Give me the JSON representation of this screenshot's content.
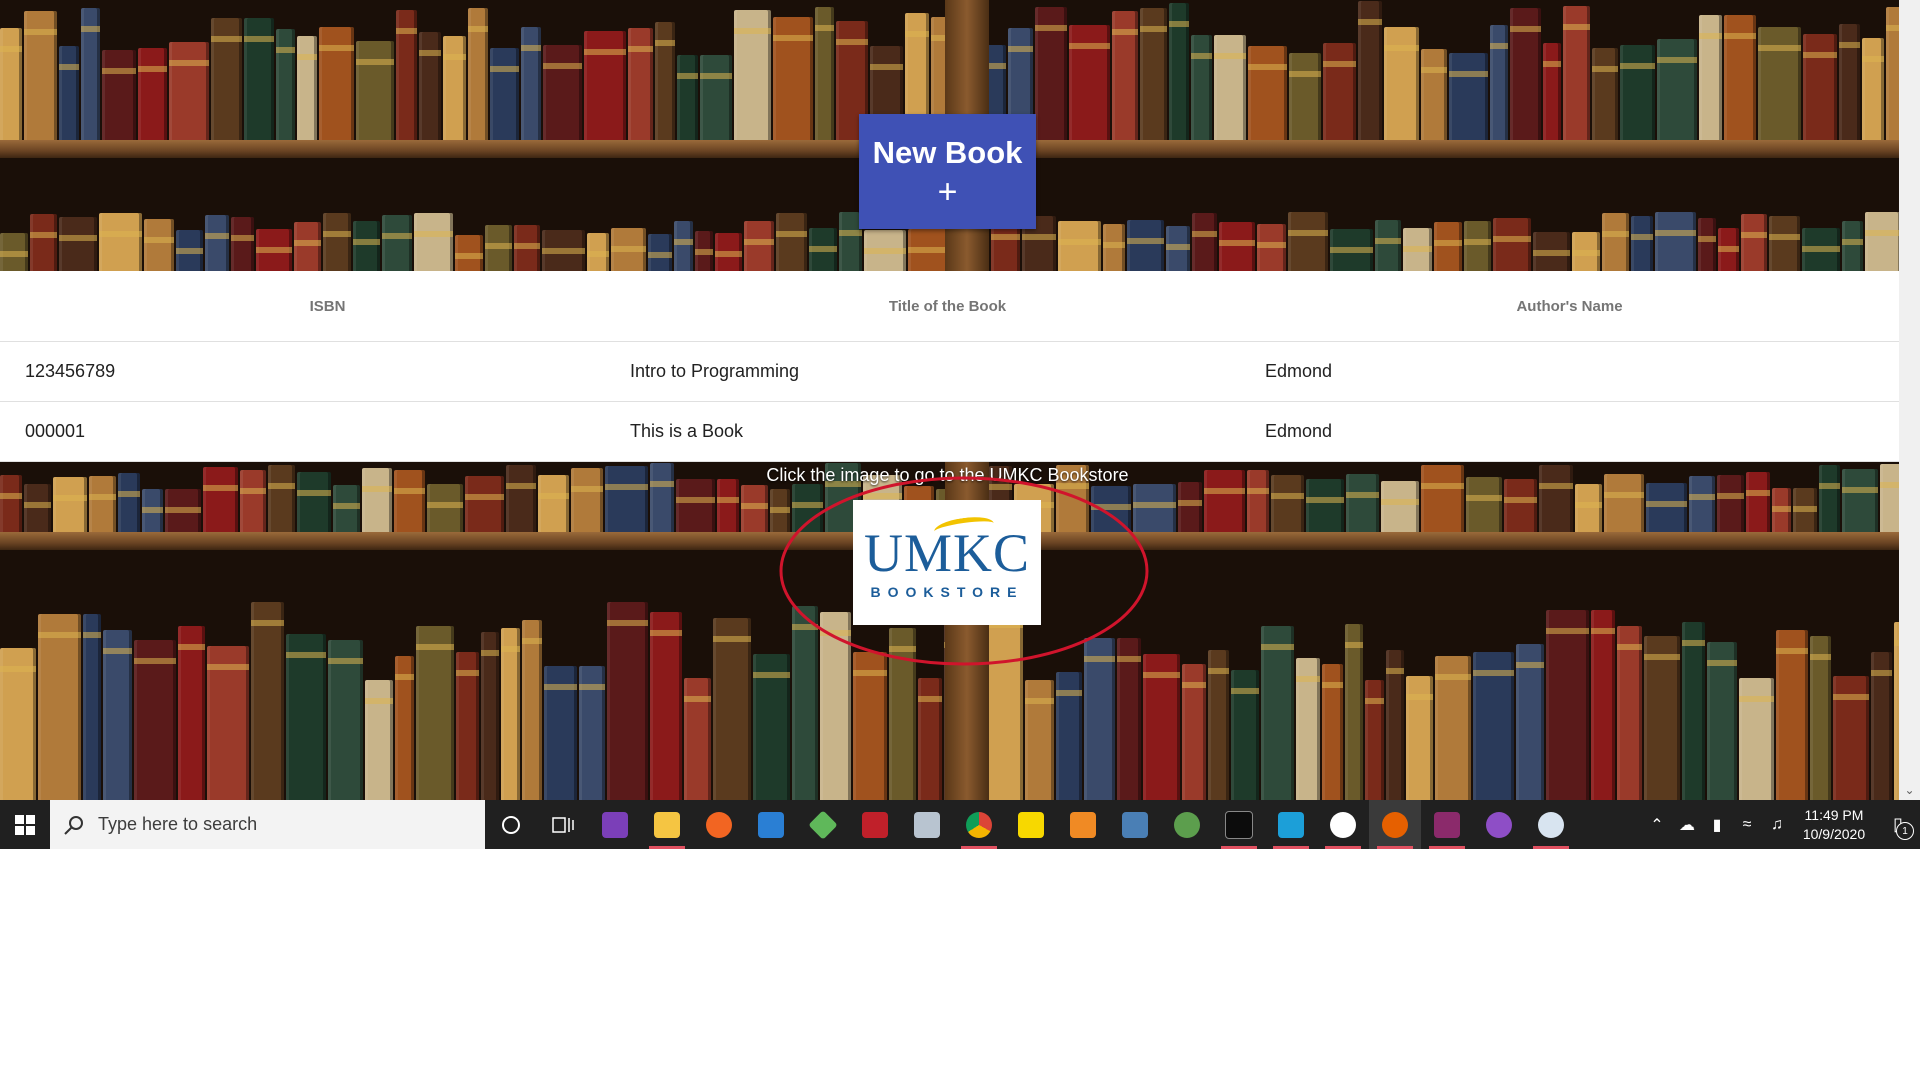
{
  "new_book_button": {
    "label": "New Book",
    "icon": "+"
  },
  "table": {
    "headers": [
      "ISBN",
      "Title of the Book",
      "Author's Name"
    ],
    "rows": [
      [
        "123456789",
        "Intro to Programming",
        "Edmond"
      ],
      [
        "000001",
        "This is a Book",
        "Edmond"
      ]
    ]
  },
  "bookstore": {
    "caption": "Click the image to go to the UMKC Bookstore",
    "logo_main": "UMKC",
    "logo_sub": "BOOKSTORE"
  },
  "taskbar": {
    "search_placeholder": "Type here to search",
    "icons": [
      "windows-start-icon",
      "search-icon",
      "cortana-icon",
      "task-view-icon",
      "visual-studio-icon",
      "file-explorer-icon",
      "origin-icon",
      "mail-icon",
      "git-icon",
      "game-icon",
      "app-icon",
      "chrome-icon",
      "sticky-notes-icon",
      "office-icon",
      "virtualbox-icon",
      "android-studio-icon",
      "terminal-icon",
      "webstorm-icon",
      "mongodb-icon",
      "firefox-icon",
      "winrar-icon",
      "github-icon",
      "paint-icon"
    ],
    "clock_time": "11:49 PM",
    "clock_date": "10/9/2020",
    "notification_count": "1"
  },
  "colors": {
    "accent": "#3f51b5",
    "annotation": "#d0142c",
    "umkc_blue": "#1c5d9a",
    "umkc_gold": "#f2c300"
  }
}
